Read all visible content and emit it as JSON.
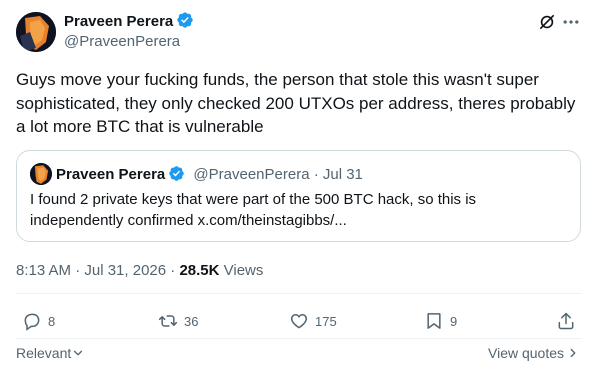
{
  "author": {
    "name": "Praveen Perera",
    "handle": "@PraveenPerera"
  },
  "tweet": {
    "text": "Guys move your fucking funds, the person that stole this wasn't super sophisticated, they only checked 200 UTXOs per address, theres probably a lot more BTC that is vulnerable"
  },
  "quote": {
    "name": "Praveen Perera",
    "handle_date": "@PraveenPerera · Jul 31",
    "text": "I found 2 private keys that were part of the 500 BTC hack, so this is independently confirmed x.com/theinstagibbs/..."
  },
  "meta": {
    "timestamp": "8:13 AM · Jul 31, 2026 · ",
    "views_count": "28.5K",
    "views_label": " Views"
  },
  "actions": {
    "replies": "8",
    "reposts": "36",
    "likes": "175",
    "bookmarks": "9"
  },
  "footer": {
    "relevant": "Relevant",
    "view_quotes": "View quotes"
  },
  "colors": {
    "accent": "#1d9bf0",
    "muted": "#536471",
    "border": "#cfd9de",
    "text": "#0f1419"
  },
  "icons": [
    "grok-icon",
    "more-icon",
    "verified-badge-icon",
    "reply-icon",
    "repost-icon",
    "like-icon",
    "bookmark-icon",
    "share-icon",
    "chevron-down-icon",
    "chevron-right-icon"
  ]
}
